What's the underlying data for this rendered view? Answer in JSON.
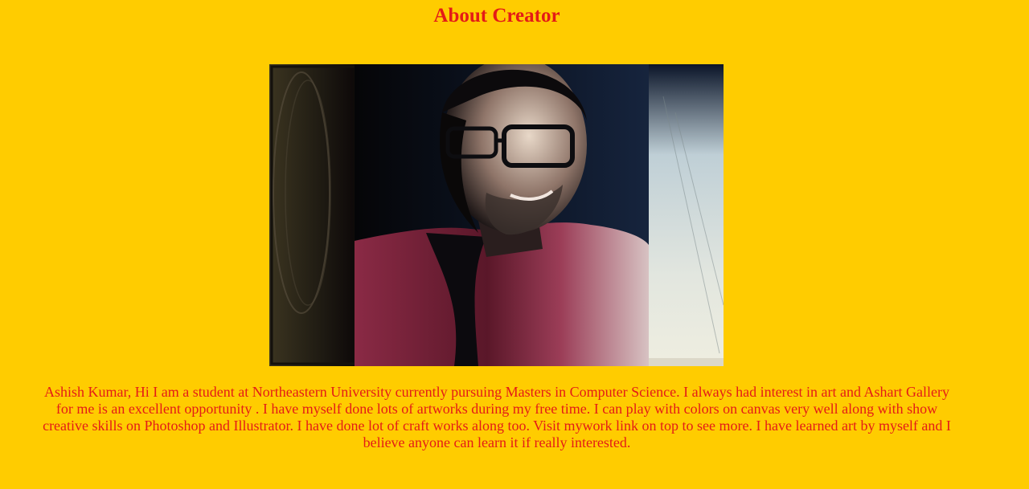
{
  "page": {
    "title": "About Creator",
    "bio": "Ashish Kumar, Hi I am a student at Northeastern University currently pursuing Masters in Computer Science. I always had interest in art and Ashart Gallery for me is an excellent opportunity . I have myself done lots of artworks during my free time. I can play with colors on canvas very well along with show creative skills on Photoshop and Illustrator. I have done lot of craft works along too. Visit mywork link on top to see more. I have learned art by myself and I believe anyone can learn it if really interested."
  },
  "colors": {
    "background": "#ffcc00",
    "text": "#e41b17"
  }
}
